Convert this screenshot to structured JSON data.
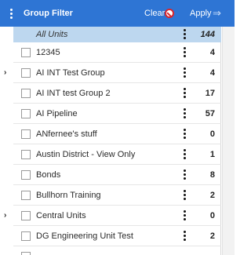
{
  "header": {
    "title": "Group Filter",
    "clear_label": "Clear",
    "apply_label": "Apply",
    "apply_arrow": "⇒",
    "accent_color": "#2e75d4"
  },
  "all_units": {
    "label": "All Units",
    "count": "144"
  },
  "units": [
    {
      "label": "12345",
      "count": "4"
    },
    {
      "label": "AI INT Test Group",
      "count": "4",
      "expandable": true
    },
    {
      "label": "AI INT test Group 2",
      "count": "17"
    },
    {
      "label": "AI Pipeline",
      "count": "57"
    },
    {
      "label": "ANfernee's stuff",
      "count": "0"
    },
    {
      "label": "Austin District - View Only",
      "count": "1"
    },
    {
      "label": "Bonds",
      "count": "8"
    },
    {
      "label": "Bullhorn Training",
      "count": "2"
    },
    {
      "label": "Central Units",
      "count": "0",
      "expandable": true
    },
    {
      "label": "DG Engineering Unit Test",
      "count": "2"
    },
    {
      "label": "",
      "count": ""
    }
  ],
  "expander_glyph": "›"
}
